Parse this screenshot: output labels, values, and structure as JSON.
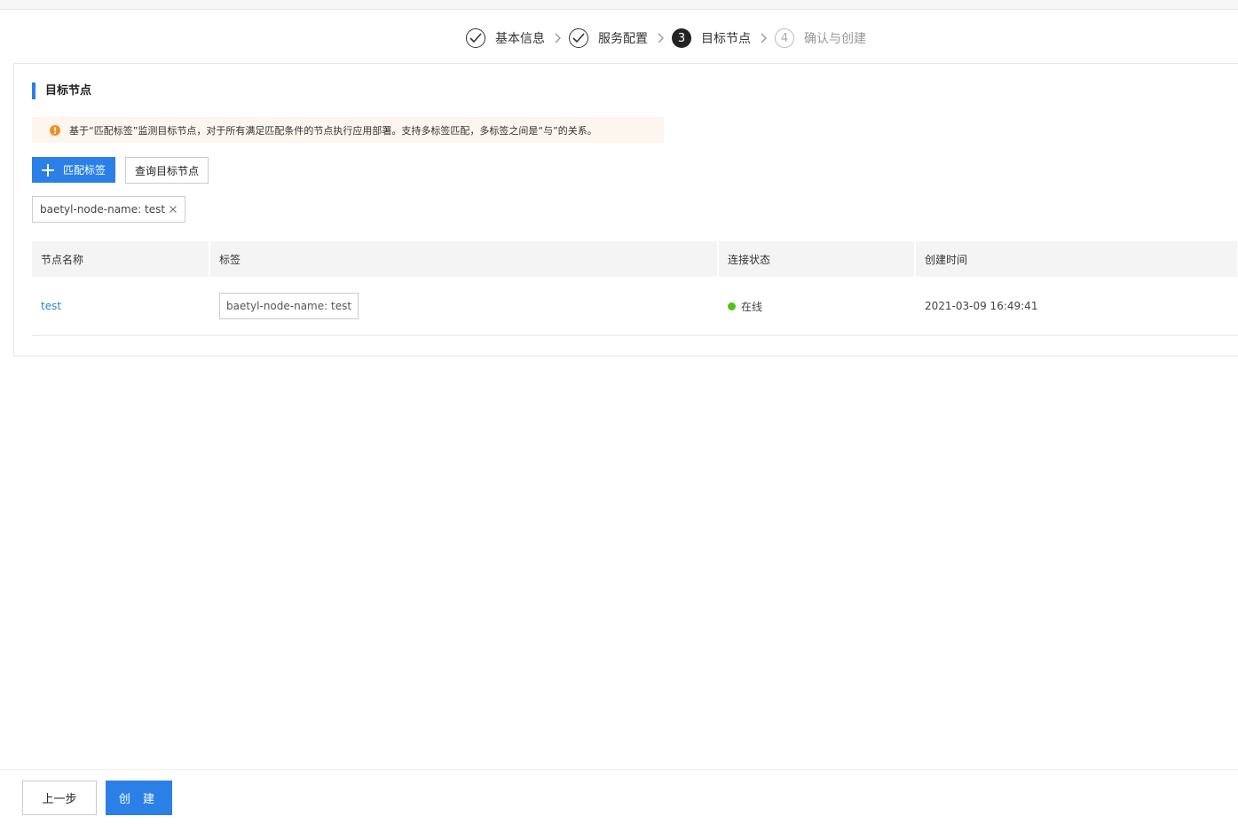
{
  "steps": [
    {
      "number": "1",
      "label": "基本信息",
      "state": "done"
    },
    {
      "number": "2",
      "label": "服务配置",
      "state": "done"
    },
    {
      "number": "3",
      "label": "目标节点",
      "state": "active"
    },
    {
      "number": "4",
      "label": "确认与创建",
      "state": "pending"
    }
  ],
  "section": {
    "title": "目标节点"
  },
  "notice": {
    "text": "基于“匹配标签”监测目标节点，对于所有满足匹配条件的节点执行应用部署。支持多标签匹配，多标签之间是“与”的关系。",
    "icon": "warning-circle-icon",
    "color": "#f0902a"
  },
  "actions": {
    "match_label_button": "匹配标签",
    "query_nodes_button": "查询目标节点"
  },
  "selected_labels": [
    "baetyl-node-name: test"
  ],
  "table": {
    "headers": [
      "节点名称",
      "标签",
      "连接状态",
      "创建时间"
    ],
    "rows": [
      {
        "name": "test",
        "label": "baetyl-node-name: test",
        "status": "在线",
        "created": "2021-03-09 16:49:41"
      }
    ]
  },
  "footer": {
    "prev_button": "上一步",
    "create_button": "创 建"
  },
  "colors": {
    "primary": "#2a80e6",
    "online": "#52c41a"
  }
}
